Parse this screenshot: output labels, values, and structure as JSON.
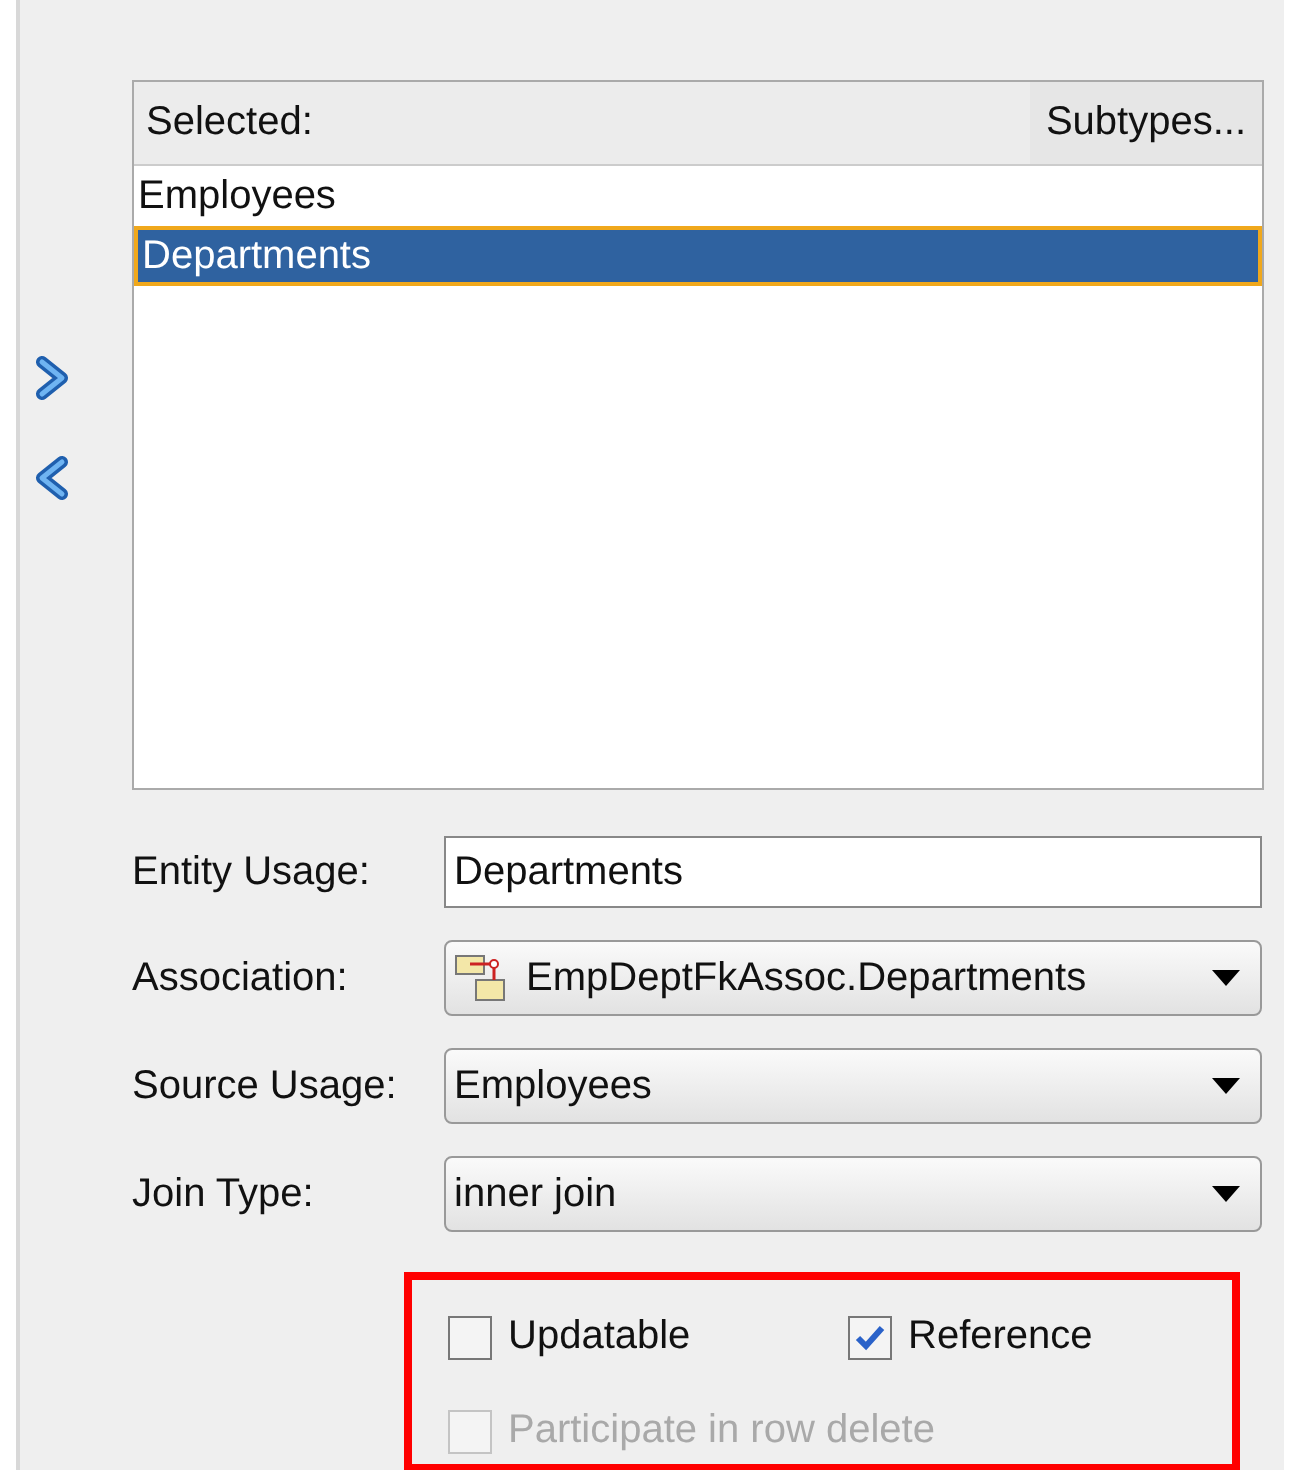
{
  "selected_list": {
    "header": "Selected:",
    "subtypes_button": "Subtypes...",
    "items": [
      {
        "label": "Employees",
        "selected": false
      },
      {
        "label": "Departments",
        "selected": true
      }
    ]
  },
  "move_buttons": [
    {
      "kind": "right"
    },
    {
      "kind": "left"
    }
  ],
  "form": [
    {
      "kind": "text",
      "label": "Entity Usage:",
      "value": "Departments"
    },
    {
      "kind": "dropdown",
      "label": "Association:",
      "value": "EmpDeptFkAssoc.Departments",
      "icon": true
    },
    {
      "kind": "dropdown",
      "label": "Source Usage:",
      "value": "Employees"
    },
    {
      "kind": "dropdown",
      "label": "Join Type:",
      "value": "inner join"
    }
  ],
  "options": {
    "highlighted": true,
    "checkboxes": [
      {
        "label": "Updatable",
        "checked": false,
        "disabled": false
      },
      {
        "label": "Reference",
        "checked": true,
        "disabled": false
      },
      {
        "label": "Participate in row delete",
        "checked": false,
        "disabled": true
      }
    ]
  }
}
